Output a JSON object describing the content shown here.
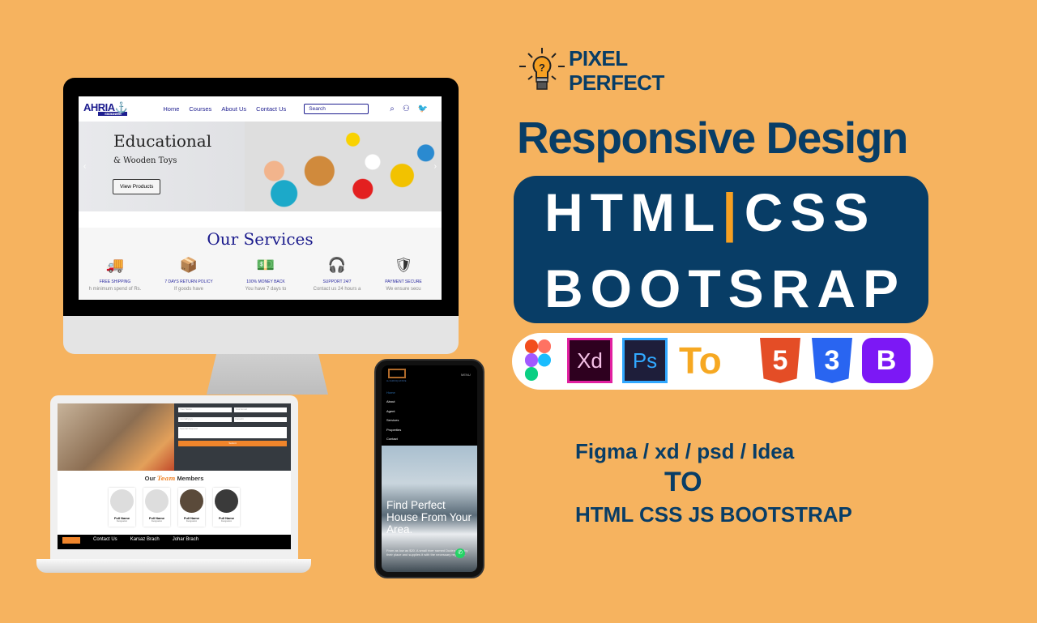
{
  "brand": {
    "line1": "PIXEL",
    "line2": "PERFECT"
  },
  "headline": "Responsive Design",
  "tech_box": {
    "html": "HTML",
    "separator": "|",
    "css": "CSS",
    "bootstrap": "BOOTSRAP"
  },
  "tools": {
    "figma": "figma-icon",
    "xd": "Xd",
    "ps": "Ps",
    "to": "To",
    "html5": "5",
    "css3": "3",
    "bootstrap": "B"
  },
  "tagline": {
    "line1": "Figma / xd / psd / Idea",
    "line2": "TO",
    "line3": "HTML CSS JS BOOTSTRAP"
  },
  "desktop_site": {
    "logo": "AHRIA",
    "logo_sub": "STATIONERS",
    "nav": [
      "Home",
      "Courses",
      "About Us",
      "Contact Us"
    ],
    "search_placeholder": "Search",
    "hero_title": "Educational",
    "hero_subtitle": "& Wooden Toys",
    "hero_button": "View Products",
    "services_title": "Our Services",
    "services": [
      {
        "title": "FREE SHIPPING",
        "desc": "h minimum spend of Rs."
      },
      {
        "title": "7 DAYS RETURN POLICY",
        "desc": "If goods have"
      },
      {
        "title": "100% MONEY BACK",
        "desc": "You have 7 days to"
      },
      {
        "title": "SUPPORT 24/7",
        "desc": "Contact us 24 hours a"
      },
      {
        "title": "PAYMENT SECURE",
        "desc": "We ensure secu"
      }
    ]
  },
  "laptop_site": {
    "form": {
      "name": "Your Name",
      "email": "Your Email",
      "date": "mm/dd/yyyy",
      "city": "Karachi",
      "request": "Special Request",
      "submit": "Submit"
    },
    "team_title_a": "Our",
    "team_title_b": "Team",
    "team_title_c": "Members",
    "members": [
      {
        "name": "Full Name",
        "role": "Designation"
      },
      {
        "name": "Full Name",
        "role": "Designation"
      },
      {
        "name": "Full Name",
        "role": "Designation"
      },
      {
        "name": "Full Name",
        "role": "Designation"
      }
    ],
    "footer": [
      "Contact Us",
      "Karsaz Brach",
      "Johar Brach"
    ]
  },
  "phone_site": {
    "logo": "AL FAROOQ ESTATE",
    "menu": "MENU",
    "nav": [
      "Home",
      "About",
      "Agent",
      "Services",
      "Properties",
      "Contact"
    ],
    "hero": "Find Perfect House From Your Area.",
    "text": "From as low as $20. A small river named Duden flows by their place and supplies it with the necessary regelialia."
  }
}
